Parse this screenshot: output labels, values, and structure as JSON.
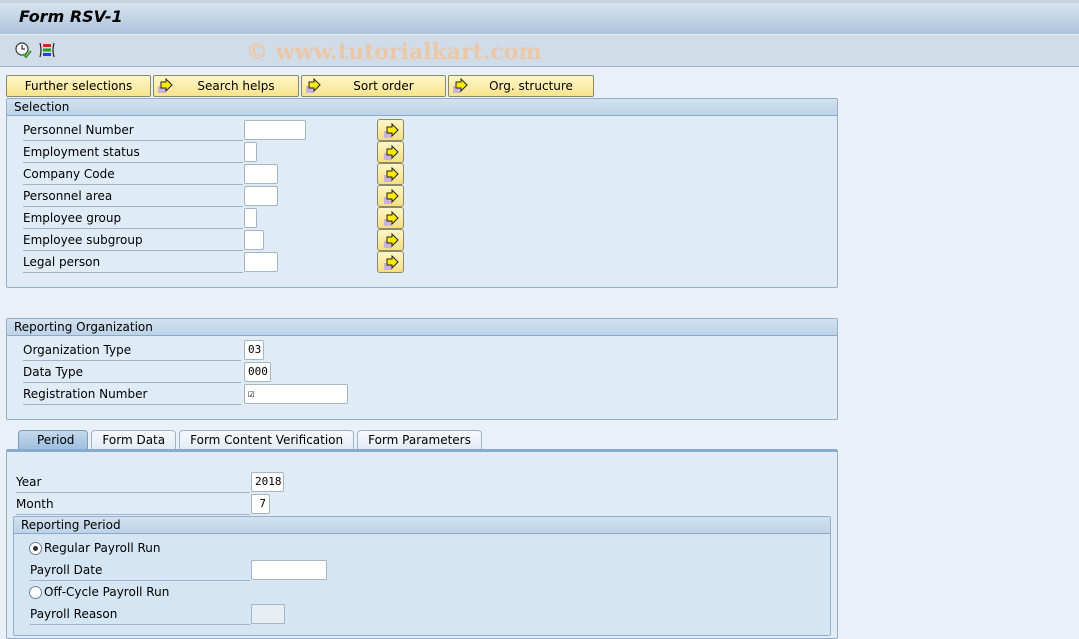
{
  "window": {
    "title": "Form RSV-1"
  },
  "toolbar": {
    "icons": [
      "execute-clock-icon",
      "selection-screen-layout-icon"
    ],
    "watermark": "© www.tutorialkart.com"
  },
  "buttons": [
    {
      "label": "Further selections",
      "icon": ""
    },
    {
      "label": "Search helps",
      "icon": "arrow-right-icon"
    },
    {
      "label": "Sort order",
      "icon": "arrow-right-icon"
    },
    {
      "label": "Org. structure",
      "icon": "arrow-right-icon"
    }
  ],
  "selection": {
    "title": "Selection",
    "rows": [
      {
        "label": "Personnel Number",
        "value": ""
      },
      {
        "label": "Employment status",
        "value": ""
      },
      {
        "label": "Company Code",
        "value": ""
      },
      {
        "label": "Personnel area",
        "value": ""
      },
      {
        "label": "Employee group",
        "value": ""
      },
      {
        "label": "Employee subgroup",
        "value": ""
      },
      {
        "label": "Legal person",
        "value": ""
      }
    ]
  },
  "reporting_org": {
    "title": "Reporting Organization",
    "rows": [
      {
        "label": "Organization Type",
        "value": "03"
      },
      {
        "label": "Data Type",
        "value": "000"
      },
      {
        "label": "Registration Number",
        "value": "☑"
      }
    ]
  },
  "tabs": [
    {
      "label": "Period",
      "active": true
    },
    {
      "label": "Form Data",
      "active": false
    },
    {
      "label": "Form Content Verification",
      "active": false
    },
    {
      "label": "Form Parameters",
      "active": false
    }
  ],
  "period": {
    "year_label": "Year",
    "year_value": "2018",
    "month_label": "Month",
    "month_value": "7",
    "reporting_period": {
      "title": "Reporting Period",
      "regular_label": "Regular Payroll Run",
      "regular_selected": true,
      "payroll_date_label": "Payroll Date",
      "payroll_date_value": "",
      "offcycle_label": "Off-Cycle Payroll Run",
      "offcycle_selected": false,
      "payroll_reason_label": "Payroll Reason",
      "payroll_reason_value": ""
    }
  }
}
